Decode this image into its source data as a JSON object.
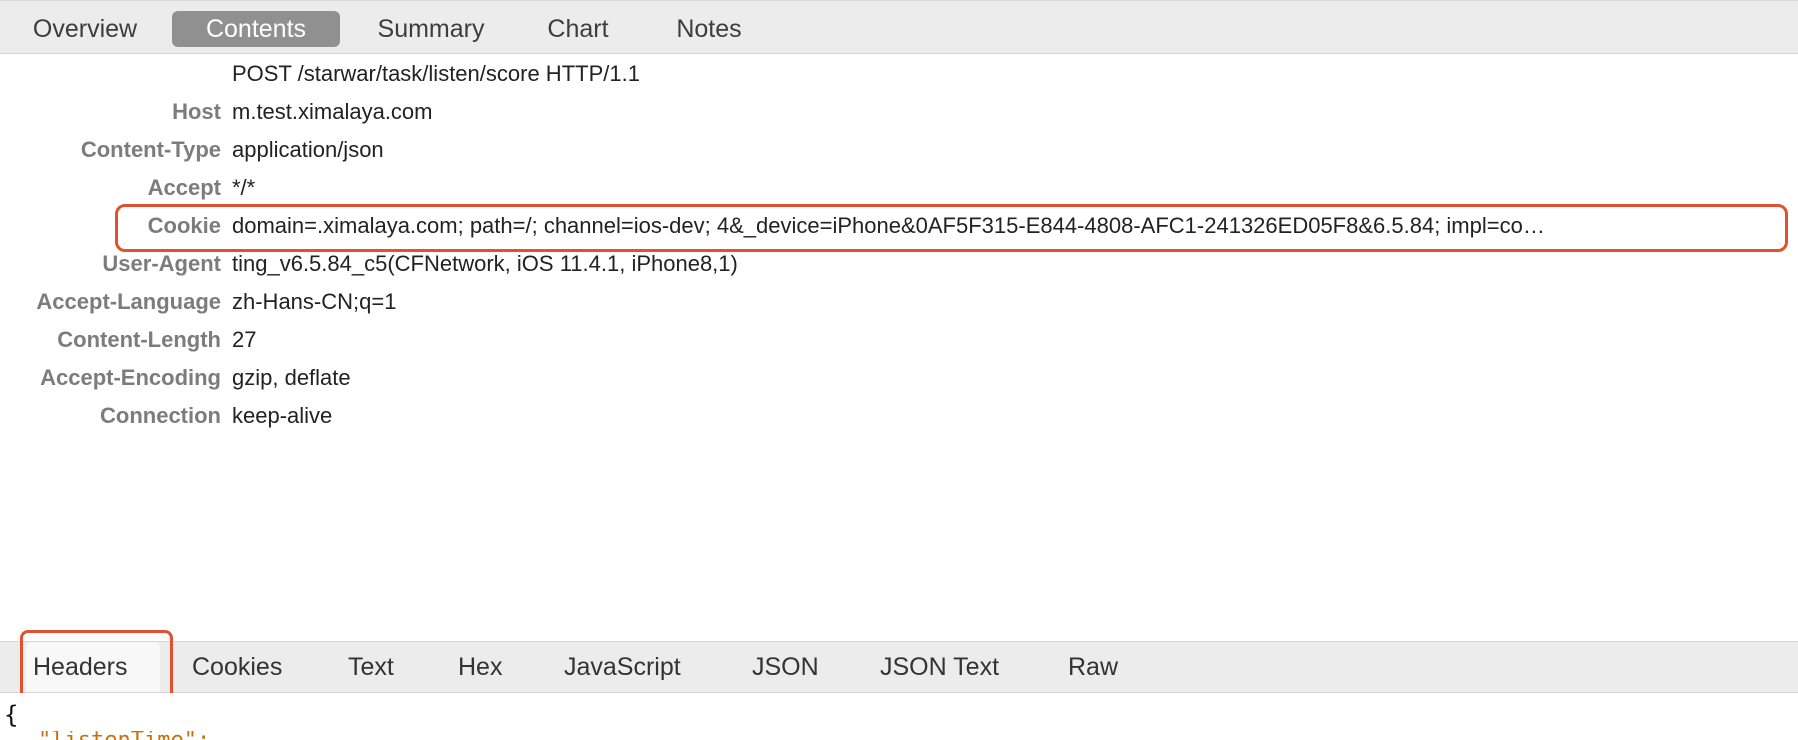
{
  "top_tabs": [
    "Overview",
    "Contents",
    "Summary",
    "Chart",
    "Notes"
  ],
  "top_tabs_selected": "Contents",
  "request_line": "POST /starwar/task/listen/score HTTP/1.1",
  "headers": [
    {
      "key": "Host",
      "value": "m.test.ximalaya.com"
    },
    {
      "key": "Content-Type",
      "value": "application/json"
    },
    {
      "key": "Accept",
      "value": "*/*"
    },
    {
      "key": "Cookie",
      "value": "domain=.ximalaya.com; path=/; channel=ios-dev; 4&_device=iPhone&0AF5F315-E844-4808-AFC1-241326ED05F8&6.5.84; impl=co…"
    },
    {
      "key": "User-Agent",
      "value": "ting_v6.5.84_c5(CFNetwork, iOS 11.4.1, iPhone8,1)"
    },
    {
      "key": "Accept-Language",
      "value": "zh-Hans-CN;q=1"
    },
    {
      "key": "Content-Length",
      "value": "27"
    },
    {
      "key": "Accept-Encoding",
      "value": "gzip, deflate"
    },
    {
      "key": "Connection",
      "value": "keep-alive"
    }
  ],
  "bottom_tabs": [
    "Headers",
    "Cookies",
    "Text",
    "Hex",
    "JavaScript",
    "JSON",
    "JSON Text",
    "Raw"
  ],
  "bottom_tabs_selected": "Headers",
  "body_text": {
    "open_brace": "{",
    "partial_line": "\"listenTime\":"
  },
  "colors": {
    "highlight": "#e2502f",
    "selected_tab": "#909090"
  }
}
